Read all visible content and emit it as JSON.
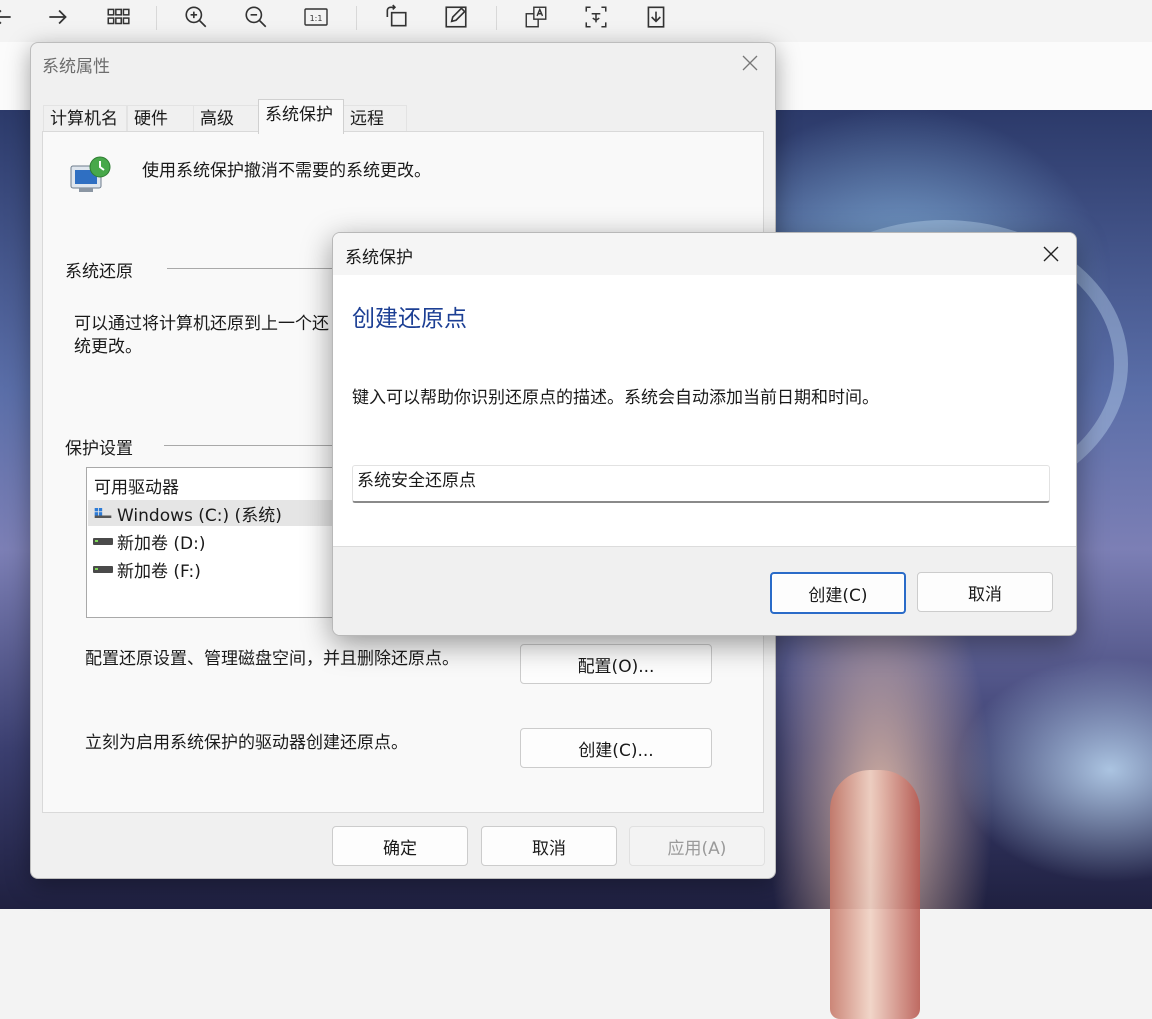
{
  "viewer_toolbar": {
    "icons": [
      "back-arrow-icon",
      "forward-arrow-icon",
      "grid-view-icon",
      "zoom-in-icon",
      "zoom-out-icon",
      "actual-size-icon",
      "rotate-icon",
      "edit-icon",
      "translate-icon",
      "ocr-icon",
      "download-icon"
    ],
    "actual_size_label": "1:1"
  },
  "system_properties": {
    "title": "系统属性",
    "tabs": [
      "计算机名",
      "硬件",
      "高级",
      "系统保护",
      "远程"
    ],
    "active_tab": "系统保护",
    "intro": "使用系统保护撤消不需要的系统更改。",
    "restore": {
      "heading": "系统还原",
      "text_line1": "可以通过将计算机还原到上一个还",
      "text_line2": "统更改。"
    },
    "protection": {
      "heading": "保护设置",
      "list_header": "可用驱动器",
      "drives": [
        {
          "label": "Windows (C:) (系统)",
          "selected": true,
          "type": "system"
        },
        {
          "label": "新加卷 (D:)",
          "selected": false,
          "type": "disk"
        },
        {
          "label": "新加卷 (F:)",
          "selected": false,
          "type": "disk"
        }
      ]
    },
    "configure_text": "配置还原设置、管理磁盘空间，并且删除还原点。",
    "configure_button": "配置(O)...",
    "create_text": "立刻为启用系统保护的驱动器创建还原点。",
    "create_button": "创建(C)...",
    "footer": {
      "ok": "确定",
      "cancel": "取消",
      "apply": "应用(A)"
    }
  },
  "dialog": {
    "title": "系统保护",
    "heading": "创建还原点",
    "description": "键入可以帮助你识别还原点的描述。系统会自动添加当前日期和时间。",
    "input_value": "系统安全还原点",
    "create_button": "创建(C)",
    "cancel_button": "取消"
  },
  "colors": {
    "accent": "#1c3f94",
    "focus_border": "#2a6bc8"
  }
}
